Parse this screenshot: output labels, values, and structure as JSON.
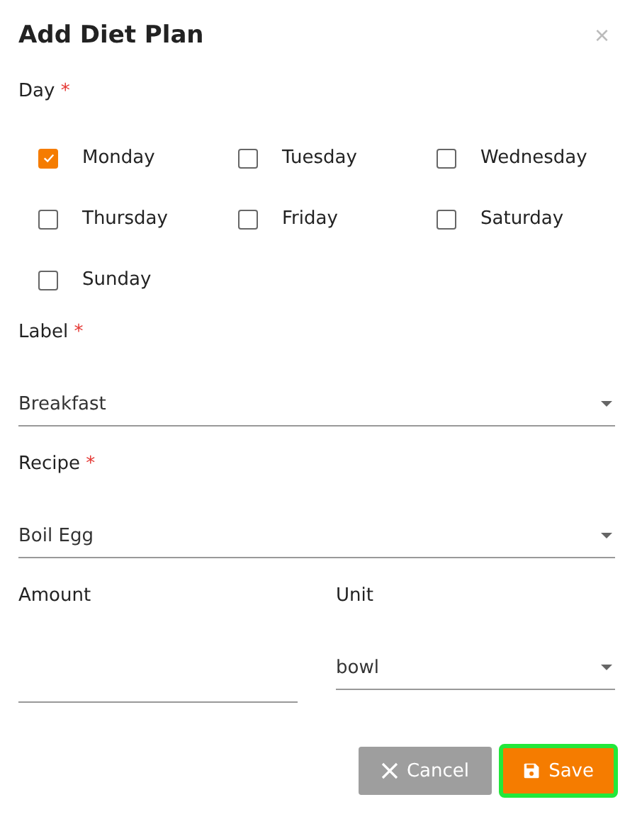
{
  "dialog": {
    "title": "Add Diet Plan",
    "close_icon": "×"
  },
  "day": {
    "label": "Day",
    "required_mark": "*",
    "options": [
      {
        "label": "Monday",
        "checked": true
      },
      {
        "label": "Tuesday",
        "checked": false
      },
      {
        "label": "Wednesday",
        "checked": false
      },
      {
        "label": "Thursday",
        "checked": false
      },
      {
        "label": "Friday",
        "checked": false
      },
      {
        "label": "Saturday",
        "checked": false
      },
      {
        "label": "Sunday",
        "checked": false
      }
    ]
  },
  "label_field": {
    "label": "Label",
    "required_mark": "*",
    "value": "Breakfast"
  },
  "recipe_field": {
    "label": "Recipe",
    "required_mark": "*",
    "value": "Boil Egg"
  },
  "amount_field": {
    "label": "Amount"
  },
  "unit_field": {
    "label": "Unit",
    "value": "bowl"
  },
  "buttons": [
    {
      "kind": "cancel",
      "label": "Cancel",
      "focused": false
    },
    {
      "kind": "save",
      "label": "Save",
      "focused": true
    }
  ]
}
